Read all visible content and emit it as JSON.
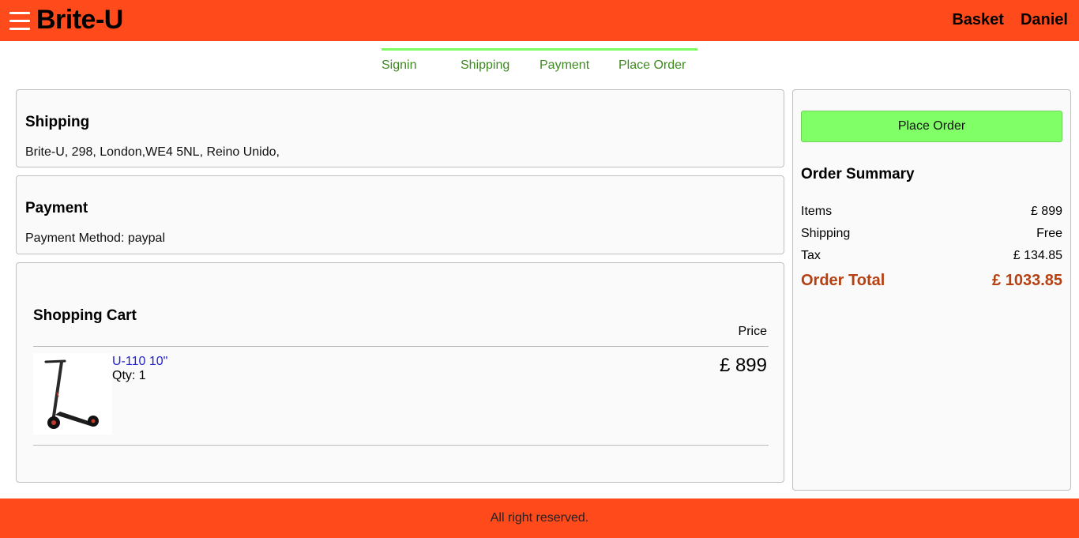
{
  "header": {
    "brand": "Brite-U",
    "links": {
      "basket": "Basket",
      "user": "Daniel"
    }
  },
  "steps": [
    "Signin",
    "Shipping",
    "Payment",
    "Place Order"
  ],
  "shipping": {
    "title": "Shipping",
    "address": "Brite-U, 298, London,WE4 5NL, Reino Unido,"
  },
  "payment": {
    "title": "Payment",
    "method": "Payment Method: paypal"
  },
  "cart": {
    "title": "Shopping Cart",
    "price_header": "Price",
    "items": [
      {
        "name": "U-110 10\"",
        "qty": "Qty: 1",
        "price": "£ 899"
      }
    ]
  },
  "summary": {
    "button": "Place Order",
    "title": "Order Summary",
    "rows": [
      {
        "label": "Items",
        "value": "£ 899"
      },
      {
        "label": "Shipping",
        "value": "Free"
      },
      {
        "label": "Tax",
        "value": "£ 134.85"
      }
    ],
    "total": {
      "label": "Order Total",
      "value": "£ 1033.85"
    }
  },
  "footer": {
    "text": "All right reserved."
  },
  "colors": {
    "header_bg": "#ff4a1c",
    "step_line": "#7cfb63",
    "step_text": "#3d8a1f",
    "button_bg": "#80ff66",
    "total_text": "#b54113",
    "link": "#2222cc"
  }
}
